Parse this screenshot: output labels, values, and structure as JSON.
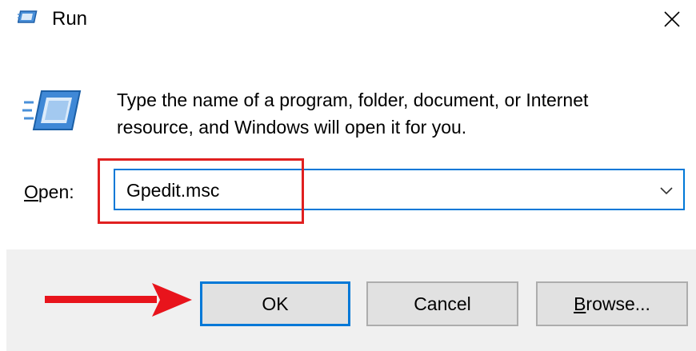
{
  "window": {
    "title": "Run",
    "close_glyph": "✕"
  },
  "content": {
    "description_line1": "Type the name of a program, folder, document, or Internet",
    "description_line2": "resource, and Windows will open it for you.",
    "open_label_mnemonic": "O",
    "open_label_rest": "pen:",
    "input_value": "Gpedit.msc"
  },
  "buttons": {
    "ok": "OK",
    "cancel": "Cancel",
    "browse_mnemonic": "B",
    "browse_rest": "rowse..."
  },
  "icons": {
    "title": "run-icon",
    "main": "run-icon",
    "close": "close-icon",
    "dropdown": "chevron-down-icon",
    "pointer": "red-arrow-icon"
  },
  "colors": {
    "focus_border": "#0078d7",
    "highlight": "#e02020",
    "button_bar": "#f0f0f0",
    "button_face": "#e1e1e1"
  }
}
